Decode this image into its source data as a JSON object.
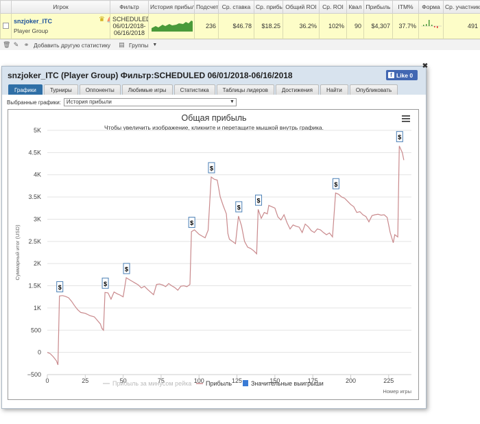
{
  "stats_table": {
    "headers": [
      "",
      "Игрок",
      "Фильтр",
      "История прибыли",
      "Подсчет",
      "Ср. ставка",
      "Ср. прибыль",
      "Общий ROI",
      "Ср. ROI",
      "Квал",
      "Прибыль",
      "ITM%",
      "Форма",
      "Ср. участники"
    ],
    "row": {
      "player": "snzjoker_ITC",
      "group": "Player Group",
      "filter": "SCHEDULED 06/01/2018-06/16/2018",
      "count": "236",
      "avg_stake": "$46.78",
      "avg_profit": "$18.25",
      "total_roi": "36.2%",
      "avg_roi": "102%",
      "qual": "90",
      "profit": "$4,307",
      "itm": "37.7%",
      "avg_entrants": "491"
    },
    "toolbar": {
      "add_stat": "Добавить другую статистику",
      "groups": "Группы"
    }
  },
  "dialog": {
    "title": "snzjoker_ITC (Player Group) Фильтр:SCHEDULED 06/01/2018-06/16/2018",
    "fb_like": "Like 0",
    "tabs": [
      "Графики",
      "Турниры",
      "Оппоненты",
      "Любимые игры",
      "Статистика",
      "Таблицы лидеров",
      "Достижения",
      "Найти",
      "Опубликовать"
    ],
    "active_tab": 0,
    "select_label": "Выбранные графики:",
    "select_value": "История прибыли"
  },
  "chart_data": {
    "type": "line",
    "title": "Общая прибыль",
    "subtitle": "Чтобы увеличить изображение, кликните и перетащите мышкой внутрь графика.",
    "ylabel": "Суммарный итог (USD)",
    "xlabel": "Номер игры",
    "ylim": [
      -500,
      5000
    ],
    "xlim": [
      0,
      240
    ],
    "y_ticks": [
      "−500",
      "0",
      "500",
      "1K",
      "1.5K",
      "2K",
      "2.5K",
      "3K",
      "3.5K",
      "4K",
      "4.5K",
      "5K"
    ],
    "x_ticks": [
      "0",
      "25",
      "50",
      "75",
      "100",
      "125",
      "150",
      "175",
      "200",
      "225"
    ],
    "grid": true,
    "legend_position": "bottom",
    "legend": [
      "Прибыль за минусом рейка",
      "Прибыль",
      "Значительные выигрыши"
    ],
    "series": [
      {
        "name": "Прибыль",
        "color": "#c9898c",
        "points": [
          [
            0,
            0
          ],
          [
            2,
            -30
          ],
          [
            4,
            -100
          ],
          [
            6,
            -190
          ],
          [
            7,
            -280
          ],
          [
            8,
            1270
          ],
          [
            10,
            1280
          ],
          [
            12,
            1260
          ],
          [
            14,
            1230
          ],
          [
            16,
            1150
          ],
          [
            18,
            1050
          ],
          [
            20,
            960
          ],
          [
            22,
            900
          ],
          [
            25,
            880
          ],
          [
            28,
            830
          ],
          [
            31,
            800
          ],
          [
            33,
            720
          ],
          [
            35,
            640
          ],
          [
            36,
            540
          ],
          [
            37,
            500
          ],
          [
            38,
            1350
          ],
          [
            40,
            1340
          ],
          [
            42,
            1200
          ],
          [
            44,
            1360
          ],
          [
            46,
            1320
          ],
          [
            48,
            1290
          ],
          [
            50,
            1250
          ],
          [
            52,
            1680
          ],
          [
            54,
            1640
          ],
          [
            56,
            1600
          ],
          [
            58,
            1560
          ],
          [
            60,
            1520
          ],
          [
            62,
            1450
          ],
          [
            64,
            1490
          ],
          [
            66,
            1420
          ],
          [
            68,
            1360
          ],
          [
            70,
            1300
          ],
          [
            72,
            1530
          ],
          [
            74,
            1540
          ],
          [
            76,
            1520
          ],
          [
            78,
            1480
          ],
          [
            80,
            1550
          ],
          [
            82,
            1500
          ],
          [
            84,
            1460
          ],
          [
            86,
            1400
          ],
          [
            88,
            1490
          ],
          [
            90,
            1500
          ],
          [
            92,
            1480
          ],
          [
            94,
            1530
          ],
          [
            95,
            2720
          ],
          [
            97,
            2760
          ],
          [
            100,
            2660
          ],
          [
            102,
            2620
          ],
          [
            104,
            2580
          ],
          [
            106,
            2750
          ],
          [
            108,
            3950
          ],
          [
            110,
            3900
          ],
          [
            112,
            3880
          ],
          [
            114,
            3500
          ],
          [
            116,
            3300
          ],
          [
            118,
            3120
          ],
          [
            119,
            2680
          ],
          [
            120,
            2550
          ],
          [
            122,
            2500
          ],
          [
            124,
            2450
          ],
          [
            126,
            3070
          ],
          [
            128,
            2850
          ],
          [
            130,
            2500
          ],
          [
            132,
            2370
          ],
          [
            134,
            2340
          ],
          [
            136,
            2290
          ],
          [
            138,
            2220
          ],
          [
            139,
            3220
          ],
          [
            141,
            3020
          ],
          [
            143,
            3150
          ],
          [
            145,
            3120
          ],
          [
            146,
            3310
          ],
          [
            148,
            3280
          ],
          [
            150,
            3250
          ],
          [
            152,
            3050
          ],
          [
            154,
            2980
          ],
          [
            156,
            3100
          ],
          [
            158,
            2920
          ],
          [
            160,
            2780
          ],
          [
            162,
            2870
          ],
          [
            164,
            2840
          ],
          [
            166,
            2820
          ],
          [
            168,
            2700
          ],
          [
            170,
            2890
          ],
          [
            172,
            2830
          ],
          [
            174,
            2740
          ],
          [
            176,
            2700
          ],
          [
            178,
            2780
          ],
          [
            180,
            2760
          ],
          [
            182,
            2700
          ],
          [
            184,
            2650
          ],
          [
            186,
            2690
          ],
          [
            188,
            2600
          ],
          [
            190,
            3590
          ],
          [
            192,
            3560
          ],
          [
            194,
            3500
          ],
          [
            196,
            3470
          ],
          [
            198,
            3400
          ],
          [
            200,
            3330
          ],
          [
            202,
            3280
          ],
          [
            204,
            3150
          ],
          [
            206,
            3170
          ],
          [
            208,
            3100
          ],
          [
            210,
            3060
          ],
          [
            212,
            2940
          ],
          [
            214,
            3080
          ],
          [
            216,
            3100
          ],
          [
            218,
            3110
          ],
          [
            220,
            3090
          ],
          [
            222,
            3100
          ],
          [
            224,
            3040
          ],
          [
            226,
            2700
          ],
          [
            228,
            2470
          ],
          [
            229,
            2650
          ],
          [
            231,
            2600
          ],
          [
            232,
            4650
          ],
          [
            234,
            4500
          ],
          [
            235,
            4330
          ]
        ]
      }
    ],
    "big_wins_x": [
      8,
      38,
      52,
      95,
      108,
      126,
      139,
      190,
      232
    ]
  }
}
